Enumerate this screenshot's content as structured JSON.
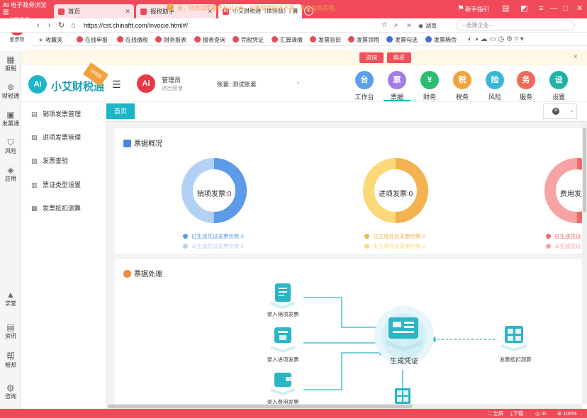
{
  "browser": {
    "app_title": "电子政务浏览器",
    "version": "V3.3.0",
    "tabs": [
      {
        "label": "首页",
        "active": false
      },
      {
        "label": "报税助手",
        "active": false
      },
      {
        "label": "小艾财税通（体验版）| 首页",
        "active": true
      }
    ],
    "guide_label": "新手指引",
    "url": "https://cst.chinaftt.com/invocie.html#/",
    "region": "湖南",
    "enterprise_placeholder": "--选择企业--",
    "logo_label": "爱票帮",
    "bookmarks_label": "收藏夹",
    "bookmarks": [
      "在线申报",
      "在线缴税",
      "财务报表",
      "报表查询",
      "完税凭证",
      "汇算清缴",
      "发票验旧",
      "发票领用",
      "发票勾选",
      "发票稀伪"
    ]
  },
  "rail": [
    {
      "label": "报税",
      "icon": "report-icon"
    },
    {
      "label": "财税通",
      "icon": "finance-icon"
    },
    {
      "label": "发票通",
      "icon": "invoice-icon"
    },
    {
      "label": "风险",
      "icon": "shield-icon"
    },
    {
      "label": "应用",
      "icon": "cube-icon"
    },
    {
      "label": "学堂",
      "icon": "graduation-icon"
    },
    {
      "label": "资讯",
      "icon": "news-icon"
    },
    {
      "label": "帮邦",
      "icon": "help-icon"
    },
    {
      "label": "咨询",
      "icon": "chat-icon"
    }
  ],
  "notice": {
    "text": "亲，您的试用期还有313天，如果使用的还不错，现在就购买吧。",
    "consult": "咨询",
    "buy": "购买"
  },
  "app": {
    "brand": "小艾财税通",
    "ribbon": "体验版",
    "logo": "Ai",
    "user": {
      "name": "管理员",
      "logout": "退出登录"
    },
    "account": {
      "label": "账套:",
      "value": "测试账套"
    },
    "modules": [
      {
        "label": "工作台",
        "color": "#5aa0e8",
        "glyph": "台",
        "active": false
      },
      {
        "label": "票据",
        "color": "#a27be6",
        "glyph": "票",
        "active": true
      },
      {
        "label": "财务",
        "color": "#2bbd73",
        "glyph": "¥",
        "active": false
      },
      {
        "label": "税务",
        "color": "#f2a43c",
        "glyph": "税",
        "active": false
      },
      {
        "label": "风险",
        "color": "#38b7d9",
        "glyph": "险",
        "active": false
      },
      {
        "label": "服务",
        "color": "#f06a5a",
        "glyph": "务",
        "active": false
      },
      {
        "label": "设置",
        "color": "#1fb3a8",
        "glyph": "设",
        "active": false
      }
    ],
    "sidebar": [
      {
        "label": "销项发票管理",
        "icon": "sales-invoice-icon"
      },
      {
        "label": "进项发票管理",
        "icon": "input-invoice-icon"
      },
      {
        "label": "发票查验",
        "icon": "verify-icon"
      },
      {
        "label": "票证类型设置",
        "icon": "type-settings-icon"
      },
      {
        "label": "发票抵扣测算",
        "icon": "calc-icon"
      }
    ],
    "home_tab": "首页"
  },
  "overview": {
    "title": "票据概况",
    "donuts": [
      {
        "label": "销项发票:0",
        "color_done": "#5b9be8",
        "color_todo": "#b3d0f5",
        "legend_done": "已生成凭证发票份数 0",
        "legend_todo": "未生成凭证发票份数 0"
      },
      {
        "label": "进项发票:0",
        "color_done": "#f5b250",
        "color_todo": "#fcd978",
        "legend_done": "已生成凭证发票份数 0",
        "legend_todo": "未生成凭证发票份数 0"
      },
      {
        "label": "费用发票",
        "color_done": "#f06a6a",
        "color_todo": "#f7a3a3",
        "legend_done": "已生成凭证",
        "legend_todo": "未生成凭证"
      }
    ]
  },
  "processing": {
    "title": "票据处理",
    "steps": {
      "sales": "录入销项发票",
      "input": "录入进项发票",
      "expense": "录入费用发票",
      "center": "生成凭证",
      "deduct": "发票抵扣测算"
    }
  },
  "status": {
    "fullscreen": "全屏",
    "download": "下载",
    "ie": "IE",
    "zoom": "100%"
  }
}
